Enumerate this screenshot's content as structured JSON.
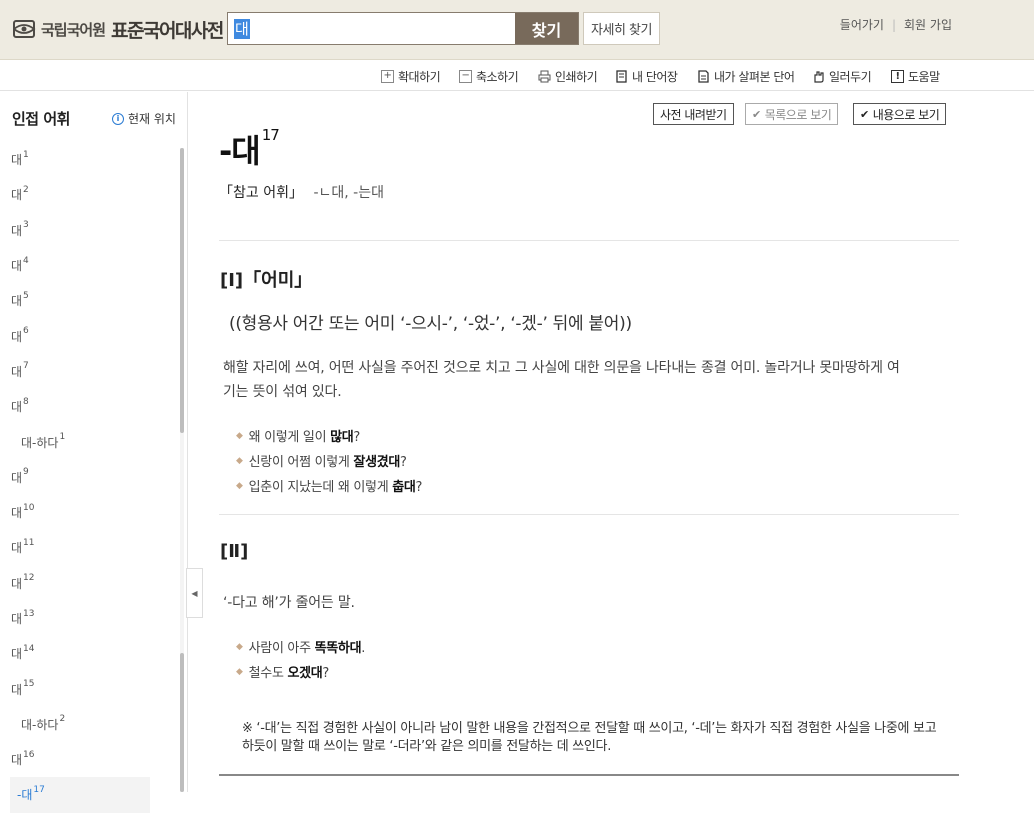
{
  "header": {
    "logo_org": "국립국어원",
    "logo_name": "표준국어대사전",
    "search_value": "대",
    "search_button": "찾기",
    "detail_button": "자세히 찾기",
    "links": [
      "들어가기",
      "회원 가입"
    ]
  },
  "toolbar": {
    "items": [
      {
        "label": "확대하기",
        "icon": "zoom-in-icon"
      },
      {
        "label": "축소하기",
        "icon": "zoom-out-icon"
      },
      {
        "label": "인쇄하기",
        "icon": "print-icon"
      },
      {
        "label": "내 단어장",
        "icon": "wordbook-icon"
      },
      {
        "label": "내가 살펴본 단어",
        "icon": "history-icon"
      },
      {
        "label": "일러두기",
        "icon": "hand-icon"
      },
      {
        "label": "도움말",
        "icon": "help-icon"
      }
    ]
  },
  "sidebar": {
    "title": "인접 어휘",
    "location": "현재 위치",
    "items": [
      {
        "word": "대",
        "sup": "1",
        "sub": false
      },
      {
        "word": "대",
        "sup": "2",
        "sub": false
      },
      {
        "word": "대",
        "sup": "3",
        "sub": false
      },
      {
        "word": "대",
        "sup": "4",
        "sub": false
      },
      {
        "word": "대",
        "sup": "5",
        "sub": false
      },
      {
        "word": "대",
        "sup": "6",
        "sub": false
      },
      {
        "word": "대",
        "sup": "7",
        "sub": false
      },
      {
        "word": "대",
        "sup": "8",
        "sub": false
      },
      {
        "word": "대-하다",
        "sup": "1",
        "sub": true
      },
      {
        "word": "대",
        "sup": "9",
        "sub": false
      },
      {
        "word": "대",
        "sup": "10",
        "sub": false
      },
      {
        "word": "대",
        "sup": "11",
        "sub": false
      },
      {
        "word": "대",
        "sup": "12",
        "sub": false
      },
      {
        "word": "대",
        "sup": "13",
        "sub": false
      },
      {
        "word": "대",
        "sup": "14",
        "sub": false
      },
      {
        "word": "대",
        "sup": "15",
        "sub": false
      },
      {
        "word": "대-하다",
        "sup": "2",
        "sub": true
      },
      {
        "word": "대",
        "sup": "16",
        "sub": false
      },
      {
        "word": "-대",
        "sup": "17",
        "sub": false,
        "active": true
      }
    ]
  },
  "content": {
    "buttons": {
      "download": "사전 내려받기",
      "list_view": "목록으로 보기",
      "content_view": "내용으로 보기"
    },
    "title": "-대",
    "title_sup": "17",
    "ref_label": "「참고 어휘」",
    "ref_value": "-ㄴ대, -는대",
    "senses": [
      {
        "head": "[Ⅰ]「어미」",
        "note": "((형용사 어간 또는 어미 ‘-으시-’, ‘-었-’, ‘-겠-’ 뒤에 붙어))",
        "definition": "해할 자리에 쓰여, 어떤 사실을 주어진 것으로 치고 그 사실에 대한 의문을 나타내는 종결 어미. 놀라거나 못마땅하게 여기는 뜻이 섞여 있다.",
        "examples": [
          {
            "pre": "왜 이렇게 일이 ",
            "bold": "많대",
            "post": "?"
          },
          {
            "pre": "신랑이 어쩜 이렇게 ",
            "bold": "잘생겼대",
            "post": "?"
          },
          {
            "pre": "입춘이 지났는데 왜 이렇게 ",
            "bold": "춥대",
            "post": "?"
          }
        ]
      },
      {
        "head": "[Ⅱ]",
        "definition": "‘-다고 해’가 줄어든 말.",
        "examples": [
          {
            "pre": "사람이 아주 ",
            "bold": "똑똑하대",
            "post": "."
          },
          {
            "pre": "철수도 ",
            "bold": "오겠대",
            "post": "?"
          }
        ]
      }
    ],
    "footnote": "※ ‘-대’는 직접 경험한 사실이 아니라 남이 말한 내용을 간접적으로 전달할 때 쓰이고, ‘-데’는 화자가 직접 경험한 사실을 나중에 보고하듯이 말할 때 쓰이는 말로 ‘-더라’와 같은 의미를 전달하는 데 쓰인다."
  }
}
